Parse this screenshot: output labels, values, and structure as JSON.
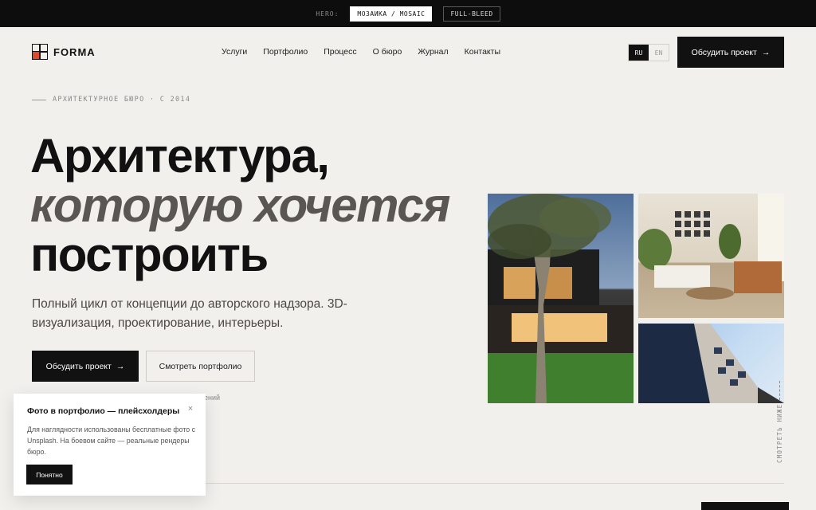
{
  "topbar": {
    "label": "HERO:",
    "options": [
      "МОЗАИКА / MOSAIC",
      "FULL-BLEED"
    ],
    "active_index": 0
  },
  "brand": {
    "name": "FORMA"
  },
  "nav": {
    "items": [
      "Услуги",
      "Портфолио",
      "Процесс",
      "О бюро",
      "Журнал",
      "Контакты"
    ]
  },
  "lang": {
    "options": [
      "RU",
      "EN"
    ],
    "active": "RU"
  },
  "header_cta": {
    "label": "Обсудить проект",
    "arrow": "→"
  },
  "hero": {
    "kicker": "АРХИТЕКТУРНОЕ БЮРО · С 2014",
    "title_line1": "Архитектура,",
    "title_line2": "которую хочется",
    "title_line3": "построить",
    "lead": "Полный цикл от концепции до авторского надзора. 3D-визуализация, проектирование, интерьеры.",
    "primary_btn": "Обсудить проект",
    "primary_arrow": "→",
    "secondary_btn": "Смотреть портфолио",
    "partial_text": "ений"
  },
  "scroll_hint": "СМОТРЕТЬ НИЖЕ",
  "notice": {
    "title": "Фото в портфолио — плейсхолдеры",
    "close": "×",
    "text": "Для наглядности использованы бесплатные фото с Unsplash. На боевом сайте — реальные рендеры бюро.",
    "button": "Понятно"
  },
  "colors": {
    "background": "#f2f0ec",
    "ink": "#111111",
    "accent": "#e0482b"
  }
}
